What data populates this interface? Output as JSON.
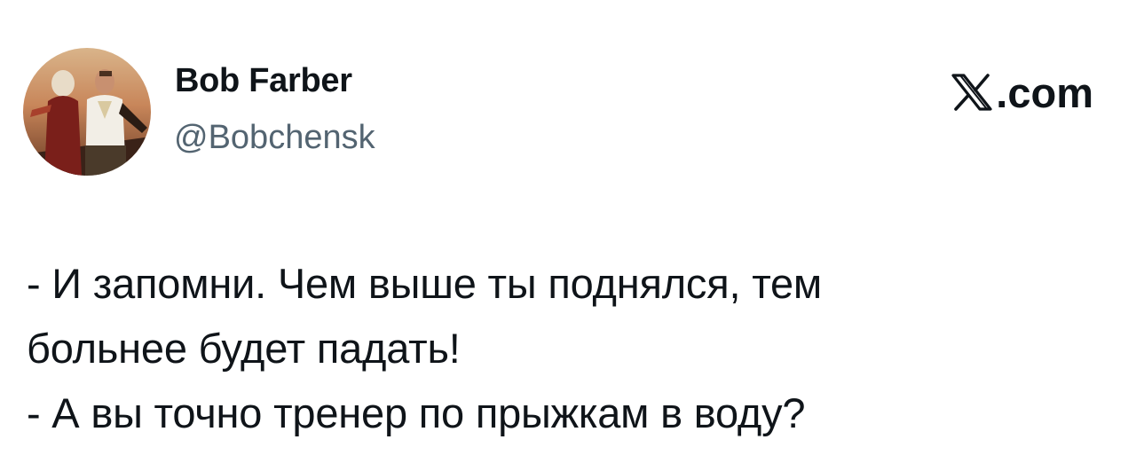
{
  "author": {
    "display_name": "Bob Farber",
    "handle": "@Bobchensk",
    "avatar_icon": "profile-photo-icon"
  },
  "brand": {
    "logo_icon": "x-logo-icon",
    "suffix": ".com"
  },
  "tweet": {
    "lines": [
      "- И запомни. Чем выше ты поднялся, тем",
      "больнее будет падать!",
      "- А вы точно тренер по прыжкам в воду?"
    ]
  },
  "colors": {
    "text": "#0f1419",
    "secondary_text": "#536471",
    "background": "#ffffff"
  }
}
